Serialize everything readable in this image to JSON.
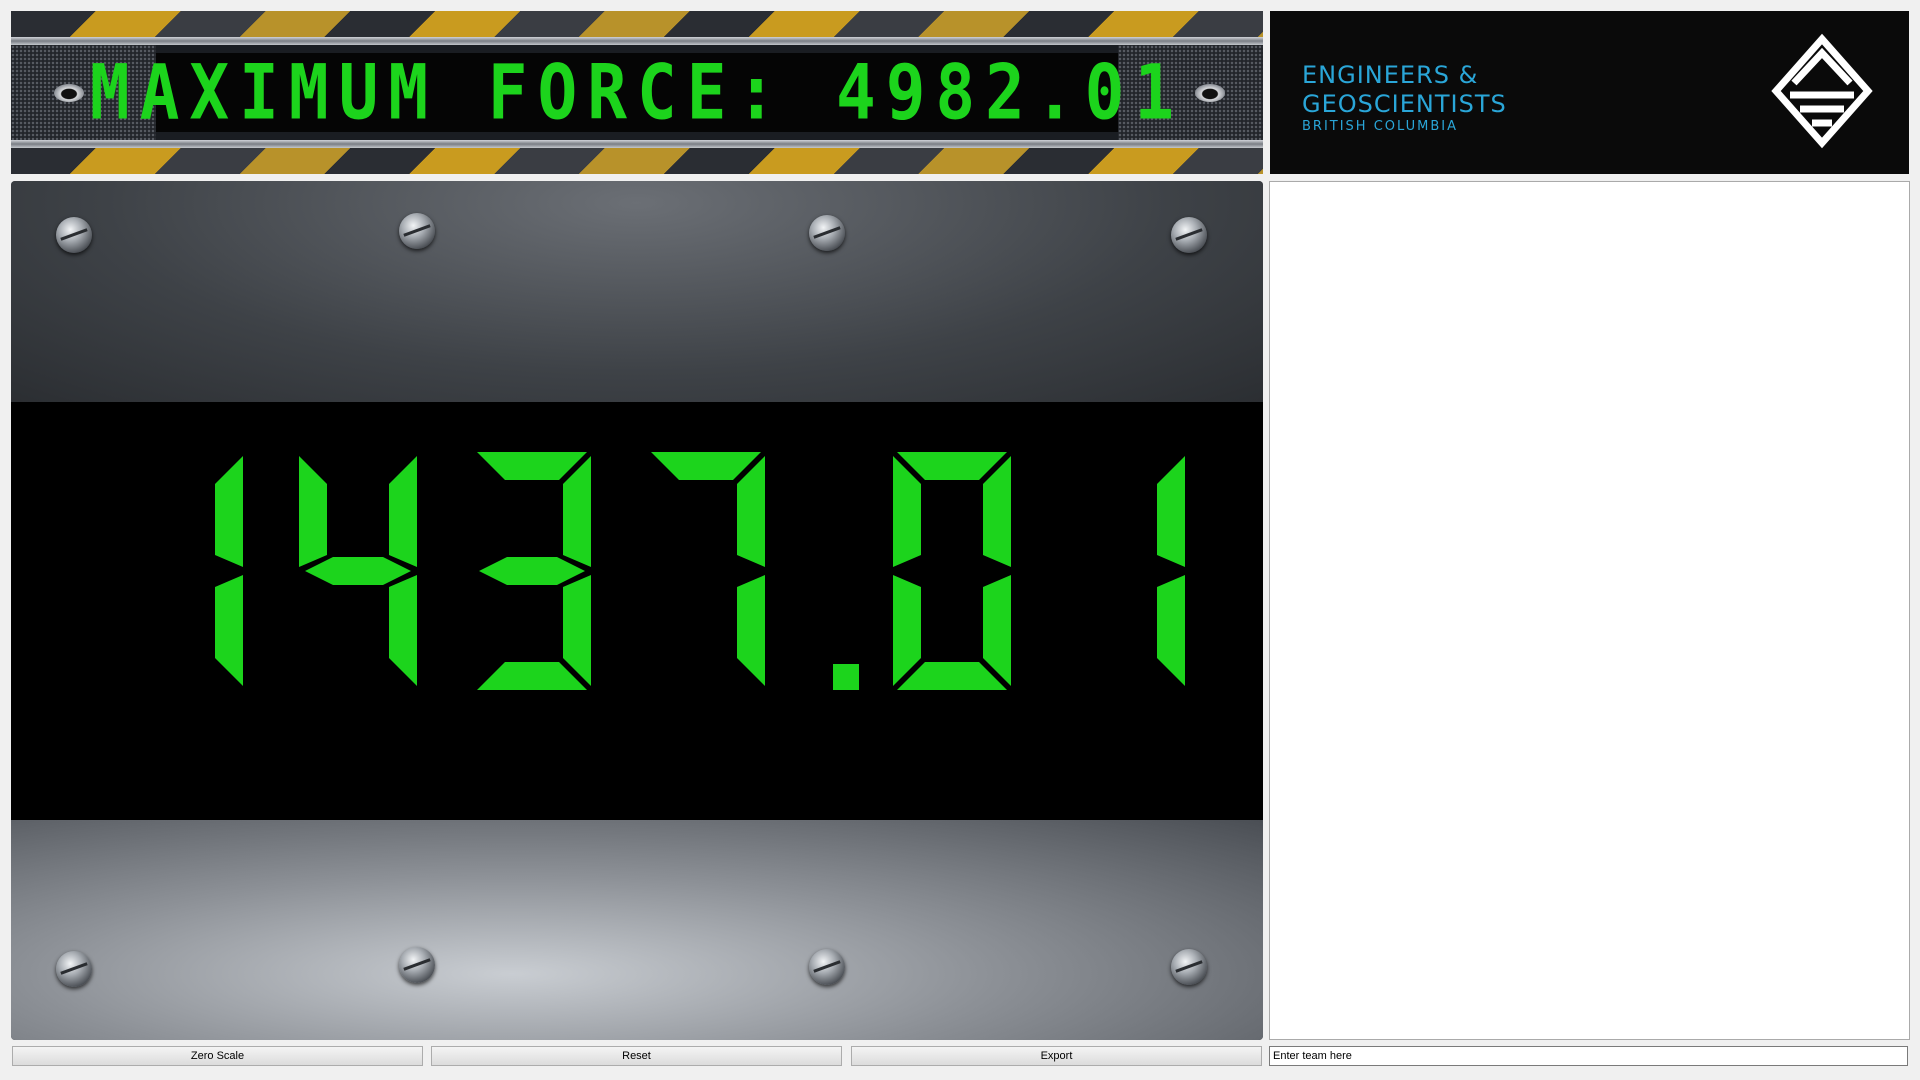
{
  "header": {
    "max_force_label": "MAXIMUM FORCE:",
    "max_force_value": "4982.01"
  },
  "logo": {
    "line1": "ENGINEERS &",
    "line2": "GEOSCIENTISTS",
    "line3": "BRITISH COLUMBIA"
  },
  "display": {
    "current_value": "1437.01",
    "digit_color": "#1cd41c"
  },
  "controls": {
    "zero_scale_label": "Zero Scale",
    "reset_label": "Reset",
    "export_label": "Export",
    "team_placeholder": "Enter team here"
  }
}
